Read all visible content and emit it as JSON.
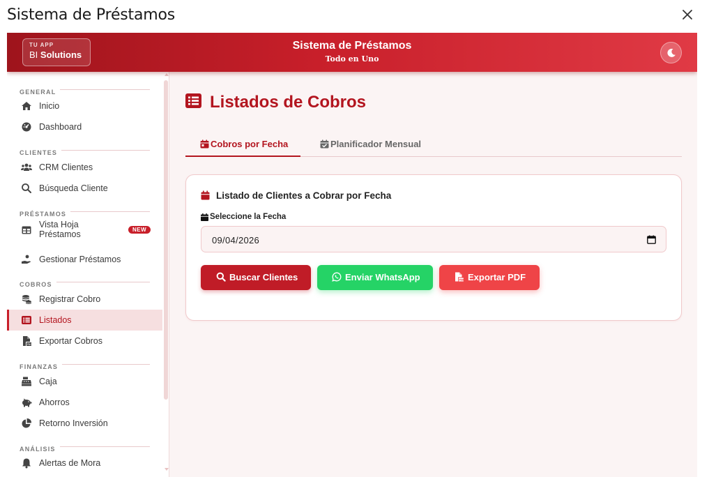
{
  "window": {
    "title": "Sistema de Préstamos",
    "close_icon": "close-icon"
  },
  "header": {
    "brand_small": "TU APP",
    "brand_prefix": "BI",
    "brand_bold": "Solutions",
    "title": "Sistema de Préstamos",
    "subtitle": "Todo en Uno",
    "theme_icon": "moon-icon"
  },
  "sidebar": {
    "sections": [
      {
        "label": "GENERAL",
        "items": [
          {
            "label": "Inicio",
            "icon": "home-icon"
          },
          {
            "label": "Dashboard",
            "icon": "gauge-icon"
          }
        ]
      },
      {
        "label": "CLIENTES",
        "items": [
          {
            "label": "CRM Clientes",
            "icon": "users-icon"
          },
          {
            "label": "Búsqueda Cliente",
            "icon": "search-icon"
          }
        ]
      },
      {
        "label": "PRÉSTAMOS",
        "items": [
          {
            "label": "Vista Hoja Préstamos",
            "label_line1": "Vista Hoja",
            "label_line2": "Préstamos",
            "icon": "table-icon",
            "badge": "NEW"
          },
          {
            "label": "Gestionar Préstamos",
            "icon": "hand-coin-icon"
          }
        ]
      },
      {
        "label": "COBROS",
        "items": [
          {
            "label": "Registrar Cobro",
            "icon": "coins-icon"
          },
          {
            "label": "Listados",
            "icon": "list-icon",
            "active": true
          },
          {
            "label": "Exportar Cobros",
            "icon": "file-export-icon"
          }
        ]
      },
      {
        "label": "FINANZAS",
        "items": [
          {
            "label": "Caja",
            "icon": "cash-register-icon"
          },
          {
            "label": "Ahorros",
            "icon": "piggy-bank-icon"
          },
          {
            "label": "Retorno Inversión",
            "icon": "pie-chart-icon"
          }
        ]
      },
      {
        "label": "ANÁLISIS",
        "items": [
          {
            "label": "Alertas de Mora",
            "icon": "bell-icon"
          }
        ]
      }
    ]
  },
  "main": {
    "page_title": "Listados de Cobros",
    "page_title_icon": "list-icon",
    "tabs": [
      {
        "label": "Cobros por Fecha",
        "icon": "calendar-day-icon",
        "active": true
      },
      {
        "label": "Planificador Mensual",
        "icon": "calendar-check-icon",
        "active": false
      }
    ],
    "card": {
      "title": "Listado de Clientes a Cobrar por Fecha",
      "title_icon": "calendar-icon",
      "field_label": "Seleccione la Fecha",
      "field_icon": "calendar-icon",
      "date_value": "09/04/2026",
      "buttons": [
        {
          "label": "Buscar Clientes",
          "icon": "search-icon"
        },
        {
          "label": "Enviar WhatsApp",
          "icon": "whatsapp-icon"
        },
        {
          "label": "Exportar PDF",
          "icon": "file-pdf-icon"
        }
      ]
    }
  },
  "colors": {
    "primary": "#c81f2a",
    "primary_dark": "#9e141c",
    "whatsapp": "#25d366",
    "pdf": "#ef4447",
    "background": "#fbf4f4"
  }
}
